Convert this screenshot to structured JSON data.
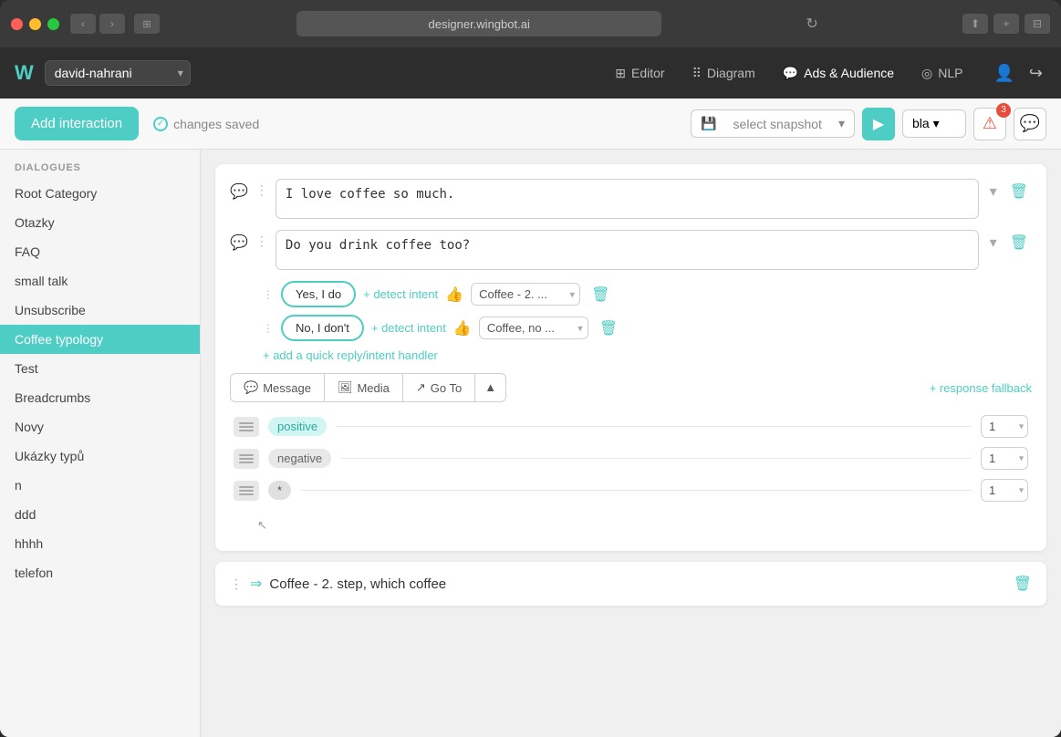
{
  "os": {
    "title_bar_url": "designer.wingbot.ai",
    "traffic_lights": [
      "red",
      "yellow",
      "green"
    ]
  },
  "app_header": {
    "logo": "W",
    "project": "david-nahrani",
    "nav_items": [
      {
        "id": "editor",
        "icon": "⊞",
        "label": "Editor"
      },
      {
        "id": "diagram",
        "icon": "⠿",
        "label": "Diagram"
      },
      {
        "id": "ads_audience",
        "icon": "💬",
        "label": "Ads & Audience"
      },
      {
        "id": "nlp",
        "icon": "◎",
        "label": "NLP"
      }
    ]
  },
  "toolbar": {
    "add_interaction_label": "Add interaction",
    "changes_saved_label": "changes saved",
    "snapshot_placeholder": "select snapshot",
    "bla_label": "bla",
    "alert_count": "3",
    "play_icon": "▶"
  },
  "sidebar": {
    "section_label": "DIALOGUES",
    "items": [
      {
        "id": "root-category",
        "label": "Root Category"
      },
      {
        "id": "otazky",
        "label": "Otazky"
      },
      {
        "id": "faq",
        "label": "FAQ"
      },
      {
        "id": "small-talk",
        "label": "small talk"
      },
      {
        "id": "unsubscribe",
        "label": "Unsubscribe"
      },
      {
        "id": "coffee-typology",
        "label": "Coffee typology",
        "active": true
      },
      {
        "id": "test",
        "label": "Test"
      },
      {
        "id": "breadcrumbs",
        "label": "Breadcrumbs"
      },
      {
        "id": "novy",
        "label": "Novy"
      },
      {
        "id": "ukazky-typu",
        "label": "Ukázky typů"
      },
      {
        "id": "n",
        "label": "n"
      },
      {
        "id": "ddd",
        "label": "ddd"
      },
      {
        "id": "hhhh",
        "label": "hhhh"
      },
      {
        "id": "telefon",
        "label": "telefon"
      }
    ]
  },
  "content": {
    "messages": [
      {
        "id": "msg1",
        "value": "I love coffee so much."
      },
      {
        "id": "msg2",
        "value": "Do you drink coffee too?"
      }
    ],
    "quick_replies": [
      {
        "id": "qr1",
        "label": "Yes, I do",
        "detect_intent_label": "+ detect intent",
        "intent_value": "Coffee - 2. ..."
      },
      {
        "id": "qr2",
        "label": "No, I don't",
        "detect_intent_label": "+ detect intent",
        "intent_value": "Coffee, no ..."
      }
    ],
    "add_qr_label": "+ add a quick reply/intent handler",
    "action_tabs": [
      {
        "id": "message",
        "icon": "💬",
        "label": "Message"
      },
      {
        "id": "media",
        "icon": "🖼",
        "label": "Media"
      },
      {
        "id": "goto",
        "icon": "↗",
        "label": "Go To"
      }
    ],
    "response_fallback_label": "+ response fallback",
    "intent_rows": [
      {
        "id": "positive",
        "tag": "positive",
        "tag_class": "positive",
        "count": "1"
      },
      {
        "id": "negative",
        "tag": "negative",
        "tag_class": "negative",
        "count": "1"
      },
      {
        "id": "wildcard",
        "tag": "*",
        "tag_class": "",
        "count": "1"
      }
    ],
    "bottom_block_title": "Coffee - 2. step, which coffee"
  }
}
